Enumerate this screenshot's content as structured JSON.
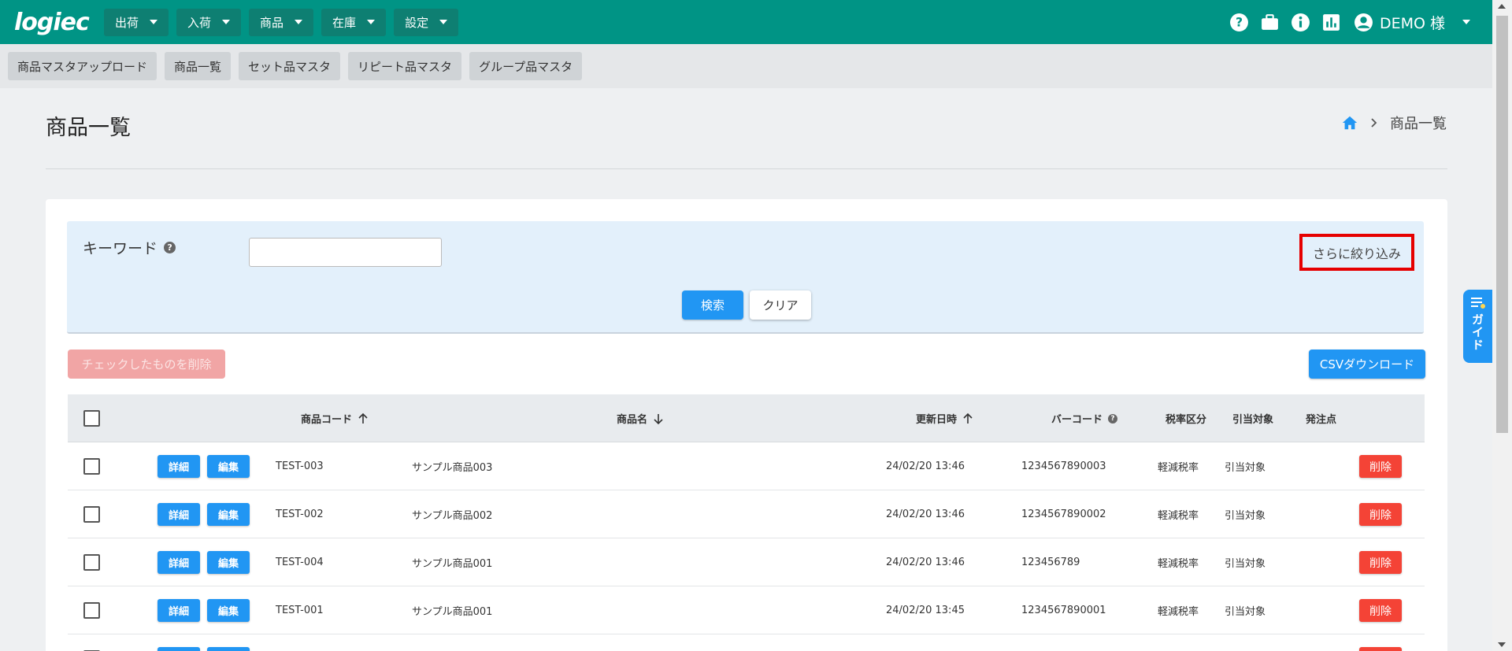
{
  "app": {
    "logo_text": "logiec",
    "brand_color": "#009485"
  },
  "nav": {
    "menus": [
      {
        "label": "出荷"
      },
      {
        "label": "入荷"
      },
      {
        "label": "商品"
      },
      {
        "label": "在庫"
      },
      {
        "label": "設定"
      }
    ],
    "icons": [
      "help-icon",
      "briefcase-icon",
      "info-icon",
      "chart-icon",
      "account-icon"
    ],
    "user": "DEMO 様"
  },
  "subnav": {
    "tabs": [
      {
        "label": "商品マスタアップロード"
      },
      {
        "label": "商品一覧"
      },
      {
        "label": "セット品マスタ"
      },
      {
        "label": "リピート品マスタ"
      },
      {
        "label": "グループ品マスタ"
      }
    ]
  },
  "page": {
    "title": "商品一覧",
    "breadcrumb": {
      "current": "商品一覧"
    }
  },
  "filter": {
    "keyword_label": "キーワード",
    "keyword_value": "",
    "keyword_placeholder": "",
    "refine_label": "さらに絞り込み",
    "search_label": "検索",
    "clear_label": "クリア"
  },
  "actions": {
    "delete_checked_label": "チェックしたものを削除",
    "csv_label": "CSVダウンロード"
  },
  "table": {
    "headers": {
      "code": "商品コード",
      "name": "商品名",
      "updated": "更新日時",
      "barcode": "バーコード",
      "tax": "税率区分",
      "allocation": "引当対象",
      "reorder": "発注点"
    },
    "detail_label": "詳細",
    "edit_label": "編集",
    "delete_label": "削除",
    "rows": [
      {
        "code": "TEST-003",
        "name": "サンプル商品003",
        "updated": "24/02/20 13:46",
        "barcode": "1234567890003",
        "tax": "軽減税率",
        "allocation": "引当対象",
        "reorder": ""
      },
      {
        "code": "TEST-002",
        "name": "サンプル商品002",
        "updated": "24/02/20 13:46",
        "barcode": "1234567890002",
        "tax": "軽減税率",
        "allocation": "引当対象",
        "reorder": ""
      },
      {
        "code": "TEST-004",
        "name": "サンプル商品001",
        "updated": "24/02/20 13:46",
        "barcode": "123456789",
        "tax": "軽減税率",
        "allocation": "引当対象",
        "reorder": ""
      },
      {
        "code": "TEST-001",
        "name": "サンプル商品001",
        "updated": "24/02/20 13:45",
        "barcode": "1234567890001",
        "tax": "軽減税率",
        "allocation": "引当対象",
        "reorder": ""
      },
      {
        "code": "",
        "name": "",
        "updated": "",
        "barcode": "",
        "tax": "",
        "allocation": "",
        "reorder": ""
      }
    ]
  },
  "guide": {
    "label": "ガイド"
  },
  "colors": {
    "primary": "#2196f3",
    "danger": "#f44336",
    "highlight": "#e60000"
  }
}
